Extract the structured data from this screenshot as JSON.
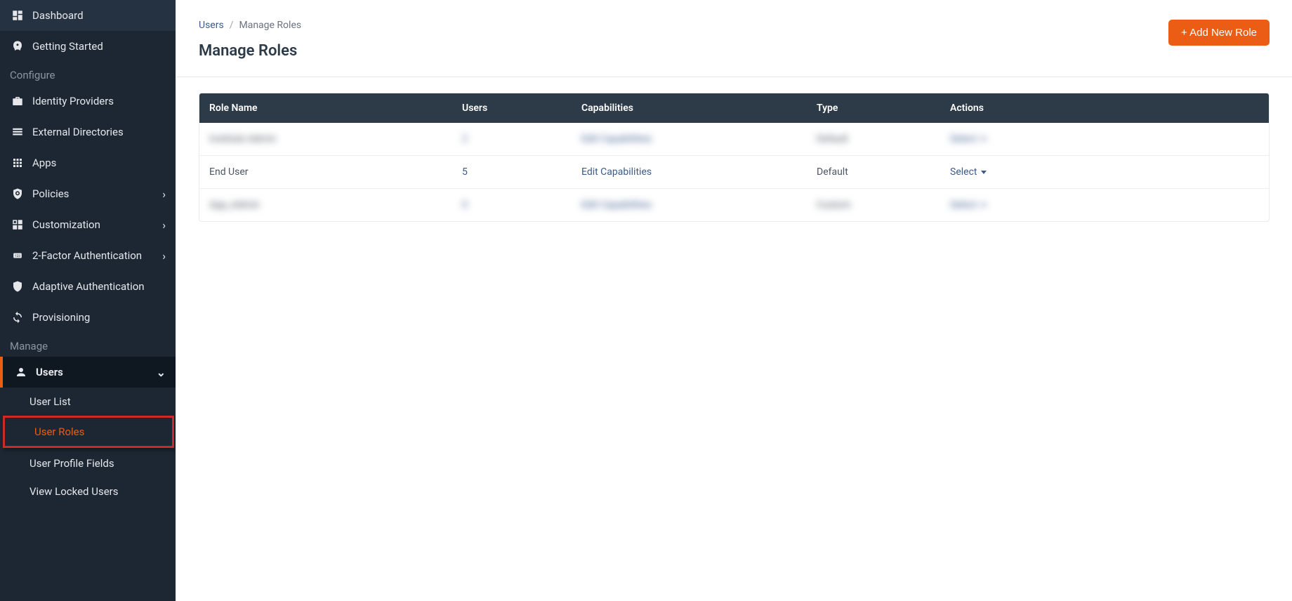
{
  "sidebar": {
    "sections": [
      {
        "items": [
          {
            "icon": "dashboard",
            "label": "Dashboard"
          },
          {
            "icon": "rocket",
            "label": "Getting Started"
          }
        ]
      },
      {
        "title": "Configure",
        "items": [
          {
            "icon": "briefcase",
            "label": "Identity Providers"
          },
          {
            "icon": "directory",
            "label": "External Directories"
          },
          {
            "icon": "apps",
            "label": "Apps"
          },
          {
            "icon": "shield",
            "label": "Policies",
            "chevron": true
          },
          {
            "icon": "customization",
            "label": "Customization",
            "chevron": true
          },
          {
            "icon": "twofa",
            "label": "2-Factor Authentication",
            "chevron": true
          },
          {
            "icon": "adaptive",
            "label": "Adaptive Authentication"
          },
          {
            "icon": "provisioning",
            "label": "Provisioning"
          }
        ]
      },
      {
        "title": "Manage",
        "items": [
          {
            "icon": "user",
            "label": "Users",
            "chevron_down": true,
            "active": true,
            "sub": [
              {
                "label": "User List"
              },
              {
                "label": "User Roles",
                "highlighted": true
              },
              {
                "label": "User Profile Fields"
              },
              {
                "label": "View Locked Users"
              }
            ]
          }
        ]
      }
    ]
  },
  "breadcrumb": {
    "a": "Users",
    "current": "Manage Roles"
  },
  "page_title": "Manage Roles",
  "add_button": "+ Add New Role",
  "table": {
    "headers": [
      "Role Name",
      "Users",
      "Capabilities",
      "Type",
      "Actions"
    ],
    "rows": [
      {
        "role": "Institute Admin",
        "users": "2",
        "cap": "Edit Capabilities",
        "type": "Default",
        "action": "Select",
        "blurred": true
      },
      {
        "role": "End User",
        "users": "5",
        "cap": "Edit Capabilities",
        "type": "Default",
        "action": "Select",
        "blurred": false
      },
      {
        "role": "App_Admin",
        "users": "0",
        "cap": "Edit Capabilities",
        "type": "Custom",
        "action": "Select",
        "blurred": true
      }
    ]
  }
}
